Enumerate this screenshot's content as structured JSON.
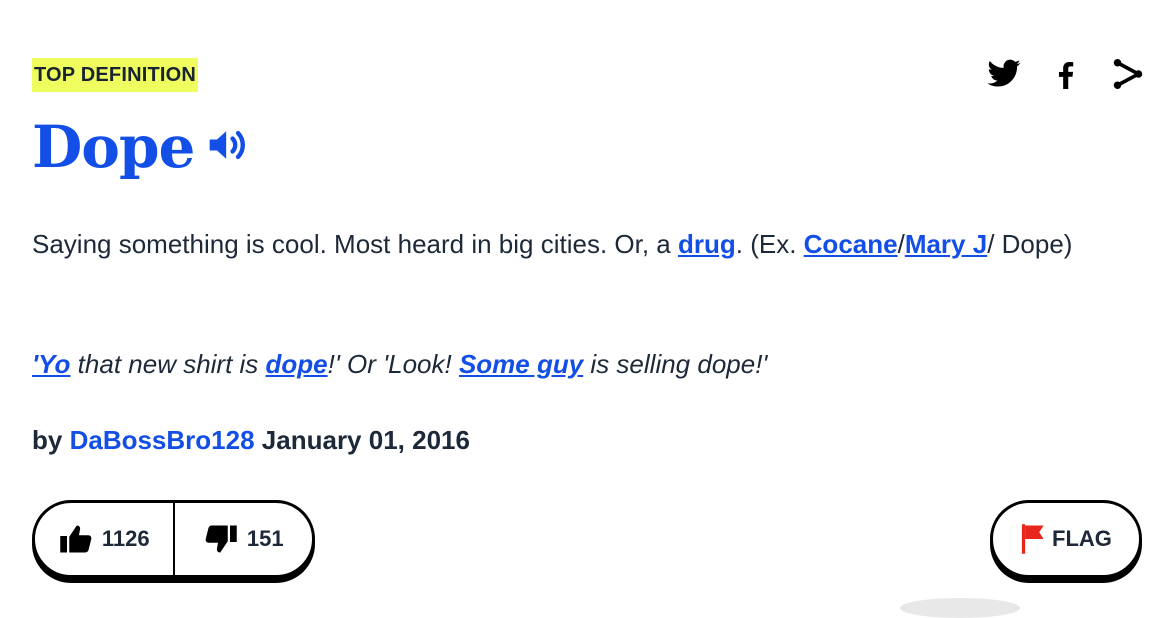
{
  "header": {
    "badge": "TOP DEFINITION"
  },
  "share": {
    "icons": [
      "twitter-icon",
      "facebook-icon",
      "share-icon"
    ]
  },
  "entry": {
    "word": "Dope",
    "meaning": {
      "part1": "Saying something is cool. Most heard in big cities. Or, a ",
      "link_drug": "drug",
      "part2": ". (Ex. ",
      "link_cocane": "Cocane",
      "sep1": "/",
      "link_maryj": "Mary J",
      "part3": "/ Dope)"
    },
    "example": {
      "link_yo": "'Yo",
      "part1": " that new shirt is ",
      "link_dope": "dope",
      "part2": "!' Or 'Look! ",
      "link_someguy": "Some guy",
      "part3": " is selling dope!'"
    },
    "contributor": {
      "prefix": "by",
      "author": "DaBossBro128",
      "date": "January 01, 2016"
    }
  },
  "votes": {
    "up": "1126",
    "down": "151"
  },
  "flag": {
    "label": "FLAG"
  },
  "colors": {
    "link": "#134fe6",
    "badge_bg": "#effd5f",
    "flag_red": "#e8261c"
  }
}
